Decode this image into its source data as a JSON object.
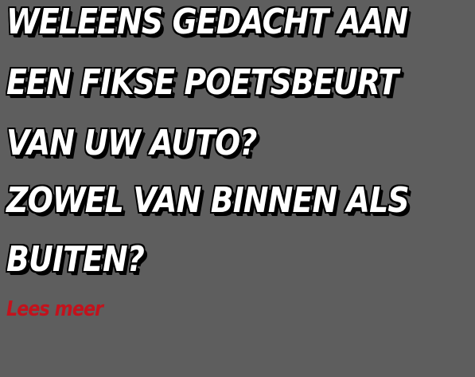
{
  "promo": {
    "headline_lines": [
      "WELEENS GEDACHT AAN",
      "EEN FIKSE POETSBEURT",
      "VAN UW AUTO?",
      "ZOWEL VAN BINNEN ALS",
      "BUITEN?"
    ],
    "read_more_label": "Lees meer",
    "colors": {
      "background": "#5e5e5e",
      "headline_text": "#ffffff",
      "headline_outline": "#000000",
      "read_more": "#c3121c"
    }
  }
}
